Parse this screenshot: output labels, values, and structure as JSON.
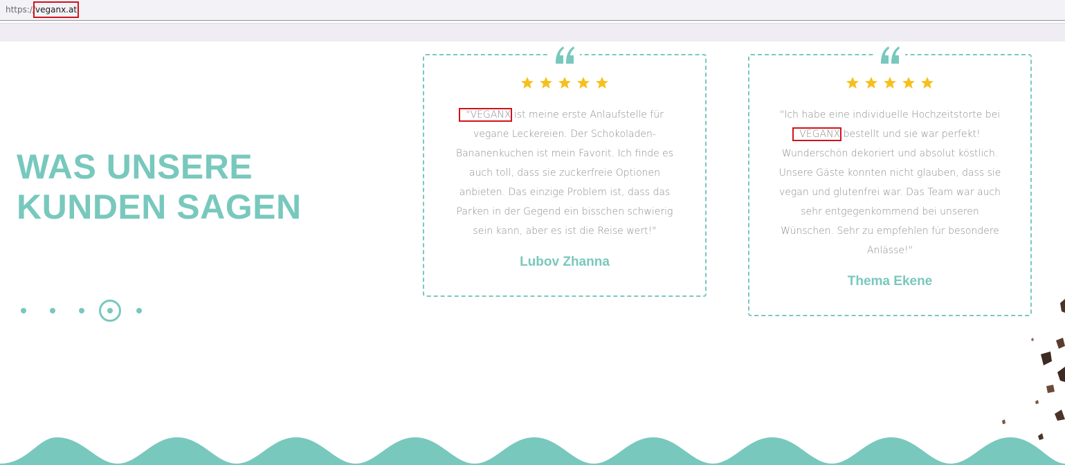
{
  "browser": {
    "url_scheme": "https://",
    "url_host": "veganx.at"
  },
  "section": {
    "heading_line1": "WAS UNSERE",
    "heading_line2": "KUNDEN SAGEN",
    "pagination": {
      "total": 5,
      "active_index": 3
    }
  },
  "testimonials": [
    {
      "rating": 5,
      "quote_open": "\"",
      "brand": "VEGANX",
      "text": " ist meine erste Anlaufstelle für vegane Leckereien. Der Schokoladen-Bananenkuchen ist mein Favorit. Ich finde es auch toll, dass sie zuckerfreie Optionen anbieten. Das einzige Problem ist, dass das Parken in der Gegend ein bisschen schwierig sein kann, aber es ist die Reise wert!\"",
      "author": "Lubov Zhanna"
    },
    {
      "rating": 5,
      "text_before": "\"Ich habe eine individuelle Hochzeitstorte bei ",
      "brand": "VEGANX",
      "text": " bestellt und sie war perfekt! Wunderschön dekoriert und absolut köstlich. Unsere Gäste konnten nicht glauben, dass sie vegan und glutenfrei war. Das Team war auch sehr entgegenkommend bei unseren Wünschen. Sehr zu empfehlen für besondere Anlässe!\"",
      "author": "Thema Ekene"
    }
  ],
  "colors": {
    "accent": "#78c8bd",
    "star": "#f6c01c",
    "body_text": "#8d8d8d",
    "highlight_box": "#d0121b"
  }
}
